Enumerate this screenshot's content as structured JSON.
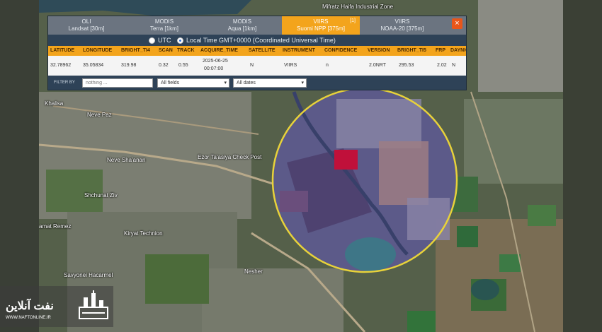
{
  "tabs": [
    {
      "title": "OLI",
      "subtitle": "Landsat [30m]"
    },
    {
      "title": "MODIS",
      "subtitle": "Terra [1km]"
    },
    {
      "title": "MODIS",
      "subtitle": "Aqua [1km]"
    },
    {
      "title": "VIIRS",
      "subtitle": "Suomi NPP [375m]",
      "badge": "[1]"
    },
    {
      "title": "VIIRS",
      "subtitle": "NOAA-20 [375m]"
    }
  ],
  "close_label": "×",
  "timezone": {
    "utc_label": "UTC",
    "local_label": "Local Time GMT+0000 (Coordinated Universal Time)",
    "selected": "local"
  },
  "table": {
    "headers": [
      "LATITUDE",
      "LONGITUDE",
      "BRIGHT_TI4",
      "SCAN",
      "TRACK",
      "ACQUIRE_TIME",
      "SATELLITE",
      "INSTRUMENT",
      "CONFIDENCE",
      "VERSION",
      "BRIGHT_TI5",
      "FRP",
      "DAYNIGHT"
    ],
    "rows": [
      {
        "latitude": "32.78962",
        "longitude": "35.05834",
        "bright_ti4": "319.98",
        "scan": "0.32",
        "track": "0.55",
        "acquire_date": "2025-06-25",
        "acquire_time": "00:07:00",
        "satellite": "N",
        "instrument": "VIIRS",
        "confidence": "n",
        "version": "2.0NRT",
        "bright_ti5": "295.53",
        "frp": "2.02",
        "daynight": "N"
      }
    ]
  },
  "filter": {
    "label": "FILTER BY",
    "placeholder": "nothing ...",
    "field_value": "All fields",
    "date_value": "All dates"
  },
  "map_labels": [
    "Khalisa",
    "Neve Paz",
    "Neve Sha'anan",
    "Ezor Ta'asiya Check Post",
    "Shchunat Ziv",
    "amat Remez",
    "Kiryat Technion",
    "Savyonei Hacarmel",
    "Nesher",
    "Mifratz Haifa Industrial Zone"
  ],
  "watermark": {
    "name": "نفت آنلاین",
    "url": "WWW.NAFTONLINE.IR"
  },
  "colors": {
    "accent": "#f3a41c",
    "panel": "#2e4257",
    "fire_marker": "#c0103a",
    "radius_ring": "#e8d23a"
  }
}
